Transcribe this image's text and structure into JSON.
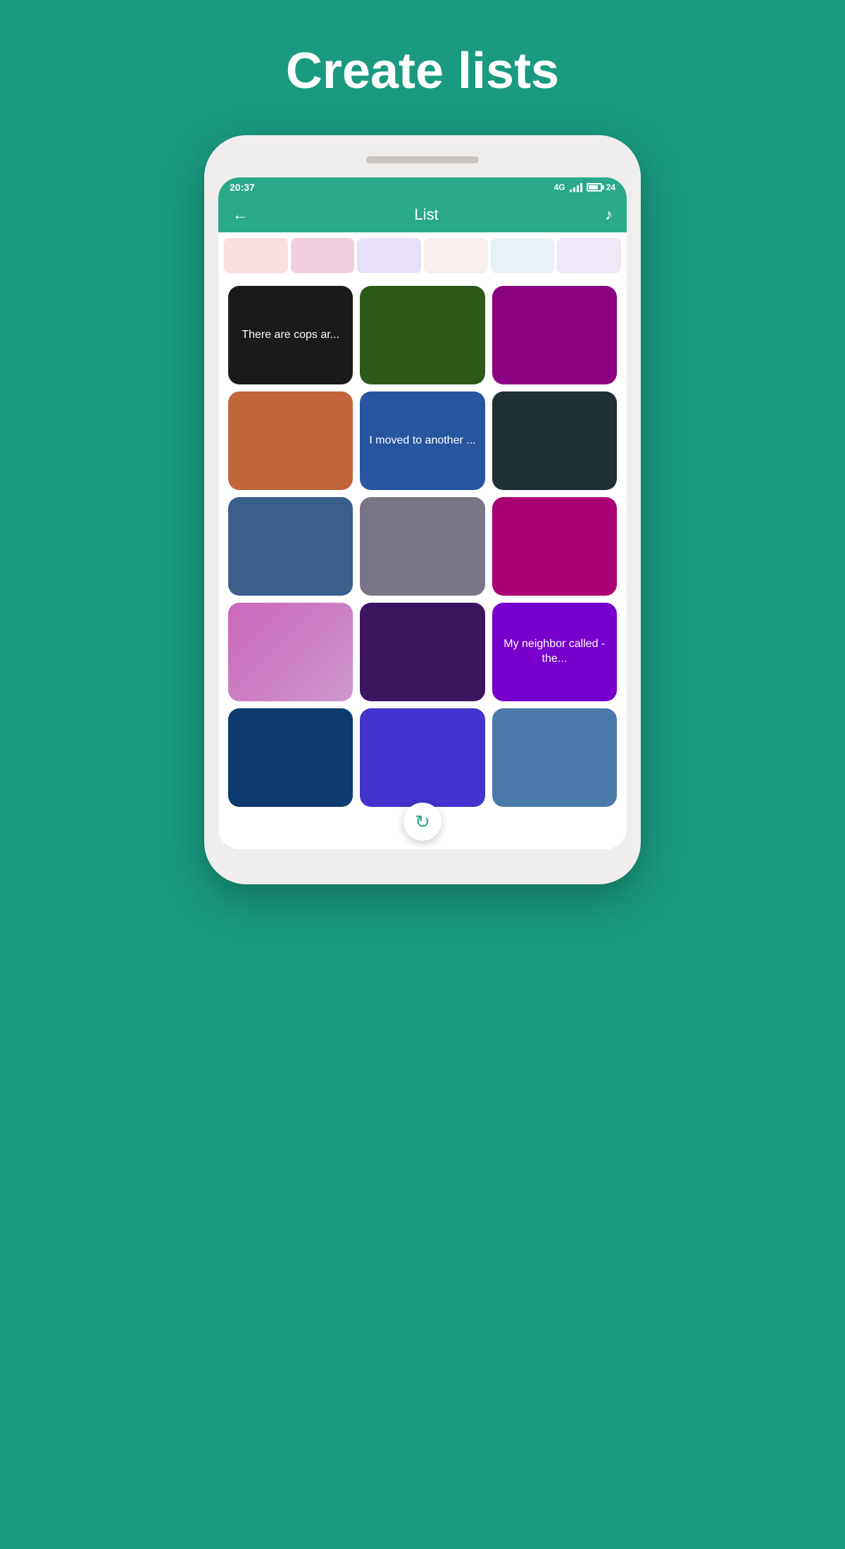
{
  "page": {
    "title": "Create lists",
    "background_color": "#1a9b80"
  },
  "status_bar": {
    "time": "20:37",
    "signal": "4G",
    "battery": "24"
  },
  "header": {
    "title": "List",
    "back_label": "←",
    "music_label": "♪"
  },
  "preview_cells": [
    {
      "color": "#f8e8e8"
    },
    {
      "color": "#f0d8e0"
    },
    {
      "color": "#e8e8f8"
    },
    {
      "color": "#f8f0e8"
    },
    {
      "color": "#e8f0f8"
    },
    {
      "color": "#f0e8f8"
    }
  ],
  "cards": [
    {
      "color": "#1a1a1a",
      "text": "There are cops ar..."
    },
    {
      "color": "#2d5a1b",
      "text": ""
    },
    {
      "color": "#8b0080",
      "text": ""
    },
    {
      "color": "#c0663a",
      "text": ""
    },
    {
      "color": "#2855a0",
      "text": "I moved to another ..."
    },
    {
      "color": "#1e3035",
      "text": ""
    },
    {
      "color": "#3a5f8a",
      "text": ""
    },
    {
      "color": "#7a7585",
      "text": ""
    },
    {
      "color": "#aa0075",
      "text": ""
    },
    {
      "color": "#cc66aa",
      "text": ""
    },
    {
      "color": "#3a1560",
      "text": ""
    },
    {
      "color": "#7700cc",
      "text": "My neighbor called - the..."
    },
    {
      "color": "#0d3a6e",
      "text": ""
    },
    {
      "color": "#4433cc",
      "text": ""
    },
    {
      "color": "#4a7aaa",
      "text": ""
    }
  ],
  "fab": {
    "icon": "↻",
    "label": "refresh"
  }
}
